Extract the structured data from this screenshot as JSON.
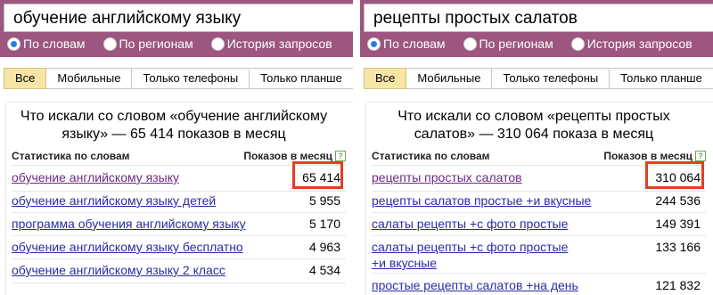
{
  "panels": [
    {
      "search_query": "обучение английскому языку",
      "radios": [
        {
          "label": "По словам",
          "selected": true
        },
        {
          "label": "По регионам",
          "selected": false
        },
        {
          "label": "История запросов",
          "selected": false
        }
      ],
      "tabs": [
        "Все",
        "Мобильные",
        "Только телефоны",
        "Только планше"
      ],
      "active_tab": "Все",
      "title_line1": "Что искали со словом «обучение английскому",
      "title_line2": "языку» — 65 414 показов в месяц",
      "col_left": "Статистика по словам",
      "col_right": "Показов в месяц",
      "help_icon_label": "?",
      "rows": [
        {
          "query": "обучение английскому языку",
          "count": "65 414",
          "highlighted": true
        },
        {
          "query": "обучение английскому языку детей",
          "count": "5 955"
        },
        {
          "query": "программа обучения английскому языку",
          "count": "5 170"
        },
        {
          "query": "обучение английскому языку бесплатно",
          "count": "4 963"
        },
        {
          "query": "обучение английскому языку 2 класс",
          "count": "4 534"
        }
      ]
    },
    {
      "search_query": "рецепты простых салатов",
      "radios": [
        {
          "label": "По словам",
          "selected": true
        },
        {
          "label": "По регионам",
          "selected": false
        },
        {
          "label": "История запросов",
          "selected": false
        }
      ],
      "tabs": [
        "Все",
        "Мобильные",
        "Только телефоны",
        "Только планше"
      ],
      "active_tab": "Все",
      "title_line1": "Что искали со словом «рецепты простых",
      "title_line2": "салатов» — 310 064 показа в месяц",
      "col_left": "Статистика по словам",
      "col_right": "Показов в месяц",
      "help_icon_label": "?",
      "rows": [
        {
          "query": "рецепты простых салатов",
          "count": "310 064",
          "highlighted": true
        },
        {
          "query": "рецепты салатов простые +и вкусные",
          "count": "244 536"
        },
        {
          "query": "салаты рецепты +с фото простые",
          "count": "149 391"
        },
        {
          "query": "салаты рецепты +с фото простые +и вкусные",
          "count": "133 166"
        },
        {
          "query": "простые рецепты салатов +на день",
          "count": "121 832"
        }
      ]
    }
  ],
  "colors": {
    "header_purple": "#9c567f",
    "active_tab": "#f7e5a8",
    "link": "#2a2aa8",
    "visited_link": "#6a2a86",
    "highlight_border": "#e2401f",
    "radio_selected": "#2a7de1"
  }
}
